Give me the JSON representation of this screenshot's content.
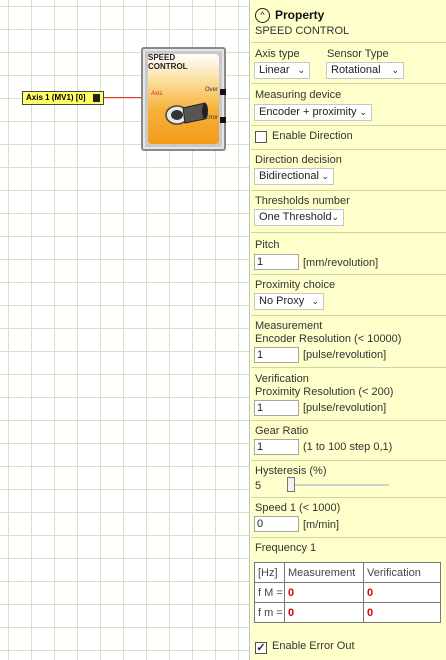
{
  "canvas": {
    "axis_input_label": "Axis 1 (MV1) [0]",
    "block": {
      "title": "SPEED\nCONTROL",
      "input_pin": "Axis",
      "output_pins": [
        "Over",
        "Error"
      ]
    }
  },
  "panel": {
    "header": "Property",
    "subheader": "SPEED CONTROL",
    "header_icon": "chevron-up-circle-icon",
    "axis_type": {
      "label": "Axis type",
      "value": "Linear"
    },
    "sensor_type": {
      "label": "Sensor Type",
      "value": "Rotational"
    },
    "measuring_device": {
      "label": "Measuring device",
      "value": "Encoder + proximity"
    },
    "enable_direction": {
      "label": "Enable Direction",
      "checked": false
    },
    "direction_decision": {
      "label": "Direction decision",
      "value": "Bidirectional"
    },
    "thresholds_number": {
      "label": "Thresholds number",
      "value": "One Threshold"
    },
    "pitch": {
      "label": "Pitch",
      "value": "1",
      "unit": "[mm/revolution]"
    },
    "proximity_choice": {
      "label": "Proximity choice",
      "value": "No Proxy"
    },
    "measurement": {
      "label": "Measurement",
      "sublabel": "Encoder Resolution  (< 10000)",
      "value": "1",
      "unit": "[pulse/revolution]"
    },
    "verification": {
      "label": "Verification",
      "sublabel": "Proximity Resolution  (< 200)",
      "value": "1",
      "unit": "[pulse/revolution]"
    },
    "gear_ratio": {
      "label": "Gear Ratio",
      "value": "1",
      "unit": "(1 to 100 step 0,1)"
    },
    "hysteresis": {
      "label": "Hysteresis (%)",
      "value": "5"
    },
    "speed1": {
      "label": "Speed 1  (< 1000)",
      "value": "0",
      "unit": "[m/min]"
    },
    "frequency": {
      "label": "Frequency 1",
      "headers": [
        "[Hz]",
        "Measurement",
        "Verification"
      ],
      "rows": [
        {
          "name": "fₘ =",
          "sub_label": "f M =",
          "measurement": "0",
          "verification": "0"
        },
        {
          "name": "fₘ =",
          "sub_label": "f m =",
          "measurement": "0",
          "verification": "0"
        }
      ]
    },
    "enable_error_out": {
      "label": "Enable Error Out",
      "checked": true
    }
  },
  "colors": {
    "panel_bg": "#ffffcc",
    "axis_box": "#ffff66",
    "block_orange": "#f29a17",
    "value_red": "#e00000",
    "wire_red": "#ff3030"
  }
}
